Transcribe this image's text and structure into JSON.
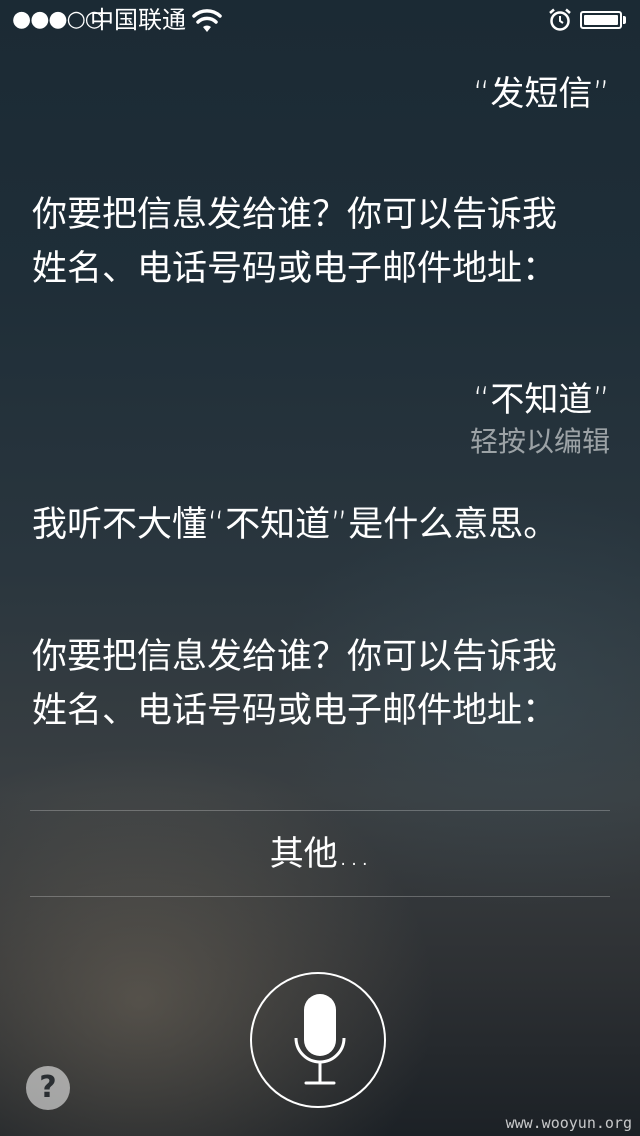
{
  "status_bar": {
    "signal": "●●●○○",
    "carrier": "中国联通"
  },
  "conversation": {
    "user_1": "“发短信”",
    "siri_1": "你要把信息发给谁？你可以告诉我姓名、电话号码或电子邮件地址：",
    "user_2": "“不知道”",
    "user_2_hint": "轻按以编辑",
    "siri_2": "我听不大懂“不知道”是什么意思。",
    "siri_3": "你要把信息发给谁？你可以告诉我姓名、电话号码或电子邮件地址："
  },
  "options": {
    "other_label": "其他..."
  },
  "controls": {
    "help_label": "?",
    "mic_icon": "microphone-icon"
  },
  "watermark": "www.wooyun.org"
}
